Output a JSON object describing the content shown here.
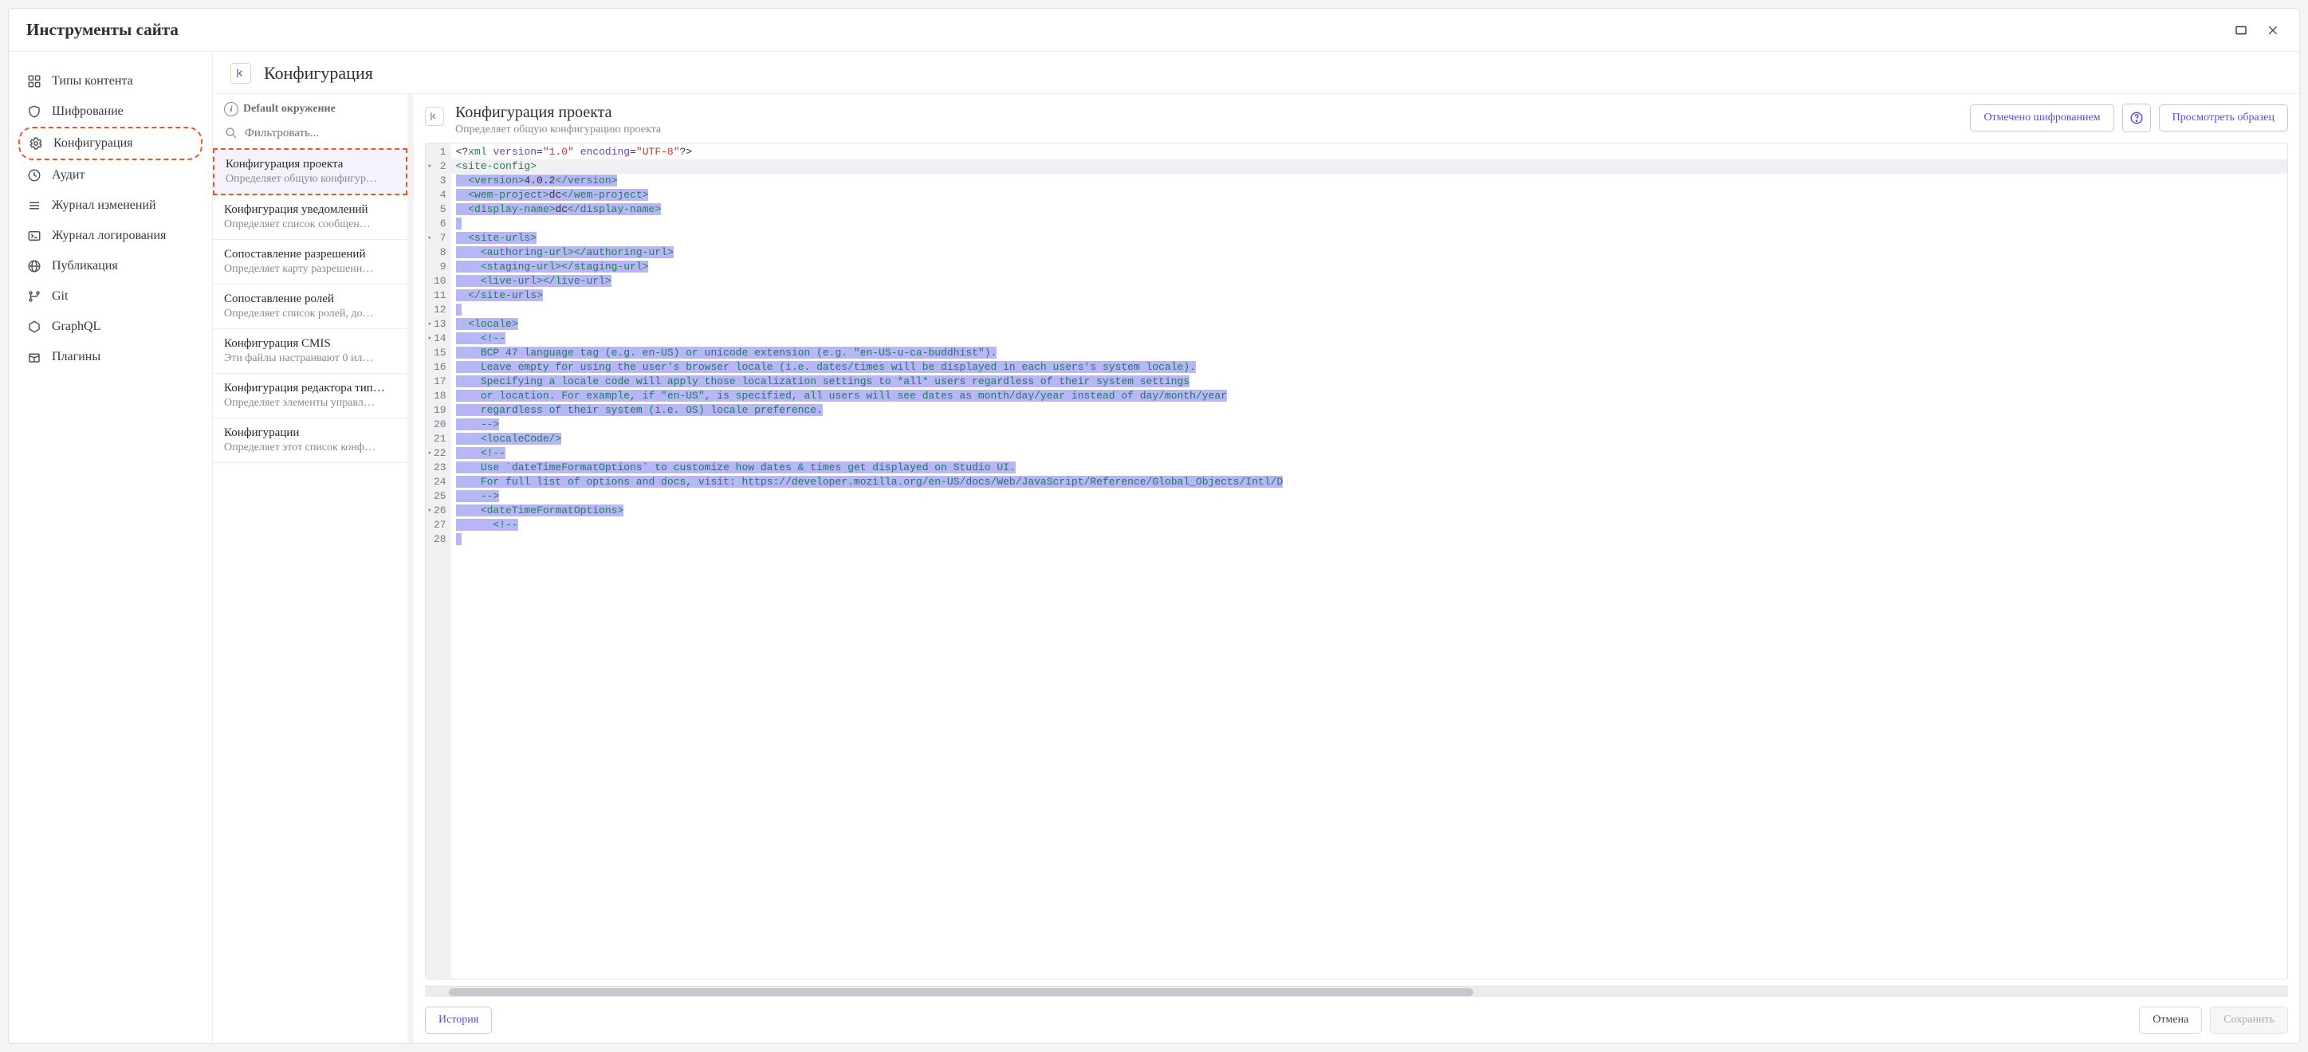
{
  "window": {
    "title": "Инструменты сайта"
  },
  "sidebar": {
    "items": [
      {
        "id": "content-types",
        "label": "Типы контента",
        "icon": "grid"
      },
      {
        "id": "encryption",
        "label": "Шифрование",
        "icon": "shield"
      },
      {
        "id": "configuration",
        "label": "Конфигурация",
        "icon": "gear",
        "highlight": true
      },
      {
        "id": "audit",
        "label": "Аудит",
        "icon": "clock"
      },
      {
        "id": "changes",
        "label": "Журнал изменений",
        "icon": "list"
      },
      {
        "id": "logging",
        "label": "Журнал логирования",
        "icon": "terminal"
      },
      {
        "id": "publication",
        "label": "Публикация",
        "icon": "globe"
      },
      {
        "id": "git",
        "label": "Git",
        "icon": "branch"
      },
      {
        "id": "graphql",
        "label": "GraphQL",
        "icon": "hex"
      },
      {
        "id": "plugins",
        "label": "Плагины",
        "icon": "box"
      }
    ]
  },
  "main": {
    "title": "Конфигурация"
  },
  "configList": {
    "envLabel": "Default окружение",
    "filterPlaceholder": "Фильтровать...",
    "items": [
      {
        "title": "Конфигурация проекта",
        "desc": "Определяет общую конфигур…",
        "active": true
      },
      {
        "title": "Конфигурация уведомлений",
        "desc": "Определяет список сообщен…"
      },
      {
        "title": "Сопоставление разрешений",
        "desc": "Определяет карту разрешени…"
      },
      {
        "title": "Сопоставление ролей",
        "desc": "Определяет список ролей, до…"
      },
      {
        "title": "Конфигурация CMIS",
        "desc": "Эти файлы настраивают 0 ил…"
      },
      {
        "title": "Конфигурация редактора тип…",
        "desc": "Определяет элементы управл…"
      },
      {
        "title": "Конфигурации",
        "desc": "Определяет этот список конф…"
      }
    ]
  },
  "editor": {
    "title": "Конфигурация проекта",
    "subtitle": "Определяет общую конфигурацию проекта",
    "actions": {
      "encrypt": "Отмечено шифрованием",
      "sample": "Просмотреть образец"
    },
    "footer": {
      "history": "История",
      "cancel": "Отмена",
      "save": "Сохранить"
    },
    "lines": [
      {
        "n": 1,
        "type": "pi",
        "raw": "<?xml version=\"1.0\" encoding=\"UTF-8\"?>"
      },
      {
        "n": 2,
        "type": "tag",
        "raw": "<site-config>",
        "cursor": true,
        "fold": true
      },
      {
        "n": 3,
        "type": "tag",
        "raw": "  <version>4.0.2</version>",
        "sel": true
      },
      {
        "n": 4,
        "type": "tag",
        "raw": "  <wem-project>dc</wem-project>",
        "sel": true
      },
      {
        "n": 5,
        "type": "tag",
        "raw": "  <display-name>dc</display-name>",
        "sel": true
      },
      {
        "n": 6,
        "type": "blank",
        "raw": "",
        "sel": true
      },
      {
        "n": 7,
        "type": "tag",
        "raw": "  <site-urls>",
        "sel": true,
        "fold": true
      },
      {
        "n": 8,
        "type": "tag",
        "raw": "    <authoring-url></authoring-url>",
        "sel": true
      },
      {
        "n": 9,
        "type": "tag",
        "raw": "    <staging-url></staging-url>",
        "sel": true
      },
      {
        "n": 10,
        "type": "tag",
        "raw": "    <live-url></live-url>",
        "sel": true
      },
      {
        "n": 11,
        "type": "tag",
        "raw": "  </site-urls>",
        "sel": true
      },
      {
        "n": 12,
        "type": "blank",
        "raw": "",
        "sel": true
      },
      {
        "n": 13,
        "type": "tag",
        "raw": "  <locale>",
        "sel": true,
        "fold": true
      },
      {
        "n": 14,
        "type": "cmt",
        "raw": "    <!--",
        "sel": true,
        "fold": true
      },
      {
        "n": 15,
        "type": "cmt",
        "raw": "    BCP 47 language tag (e.g. en-US) or unicode extension (e.g. \"en-US-u-ca-buddhist\").",
        "sel": true
      },
      {
        "n": 16,
        "type": "cmt",
        "raw": "    Leave empty for using the user's browser locale (i.e. dates/times will be displayed in each users's system locale).",
        "sel": true
      },
      {
        "n": 17,
        "type": "cmt",
        "raw": "    Specifying a locale code will apply those localization settings to *all* users regardless of their system settings",
        "sel": true
      },
      {
        "n": 18,
        "type": "cmt",
        "raw": "    or location. For example, if \"en-US\", is specified, all users will see dates as month/day/year instead of day/month/year",
        "sel": true
      },
      {
        "n": 19,
        "type": "cmt",
        "raw": "    regardless of their system (i.e. OS) locale preference.",
        "sel": true
      },
      {
        "n": 20,
        "type": "cmt",
        "raw": "    -->",
        "sel": true
      },
      {
        "n": 21,
        "type": "tag",
        "raw": "    <localeCode/>",
        "sel": true
      },
      {
        "n": 22,
        "type": "cmt",
        "raw": "    <!--",
        "sel": true,
        "fold": true
      },
      {
        "n": 23,
        "type": "cmt",
        "raw": "    Use `dateTimeFormatOptions` to customize how dates & times get displayed on Studio UI.",
        "sel": true
      },
      {
        "n": 24,
        "type": "cmt",
        "raw": "    For full list of options and docs, visit: https://developer.mozilla.org/en-US/docs/Web/JavaScript/Reference/Global_Objects/Intl/D",
        "sel": true
      },
      {
        "n": 25,
        "type": "cmt",
        "raw": "    -->",
        "sel": true
      },
      {
        "n": 26,
        "type": "tag",
        "raw": "    <dateTimeFormatOptions>",
        "sel": true,
        "fold": true
      },
      {
        "n": 27,
        "type": "cmt",
        "raw": "      <!--",
        "sel": true
      },
      {
        "n": 28,
        "type": "blank",
        "raw": "",
        "sel": true
      }
    ]
  }
}
